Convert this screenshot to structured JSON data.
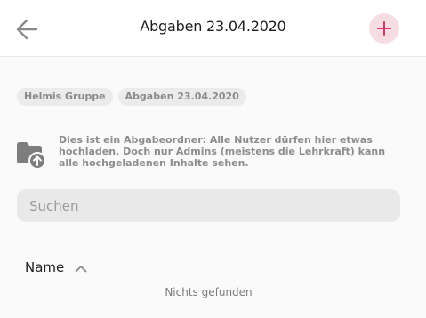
{
  "header": {
    "title": "Abgaben 23.04.2020",
    "back_icon": "arrow-left-icon",
    "add_icon": "plus-icon",
    "accent_color": "#d6336c"
  },
  "breadcrumbs": [
    {
      "label": "Helmis Gruppe"
    },
    {
      "label": "Abgaben 23.04.2020"
    }
  ],
  "info": {
    "icon": "folder-upload-icon",
    "text": "Dies ist ein Abgabeordner: Alle Nutzer dürfen hier etwas hochladen. Doch nur Admins (meistens die Lehrkraft) kann alle hochgeladenen Inhalte sehen."
  },
  "search": {
    "placeholder": "Suchen",
    "value": ""
  },
  "list": {
    "sort_label": "Name",
    "sort_icon": "chevron-up-icon",
    "empty_text": "Nichts gefunden"
  }
}
